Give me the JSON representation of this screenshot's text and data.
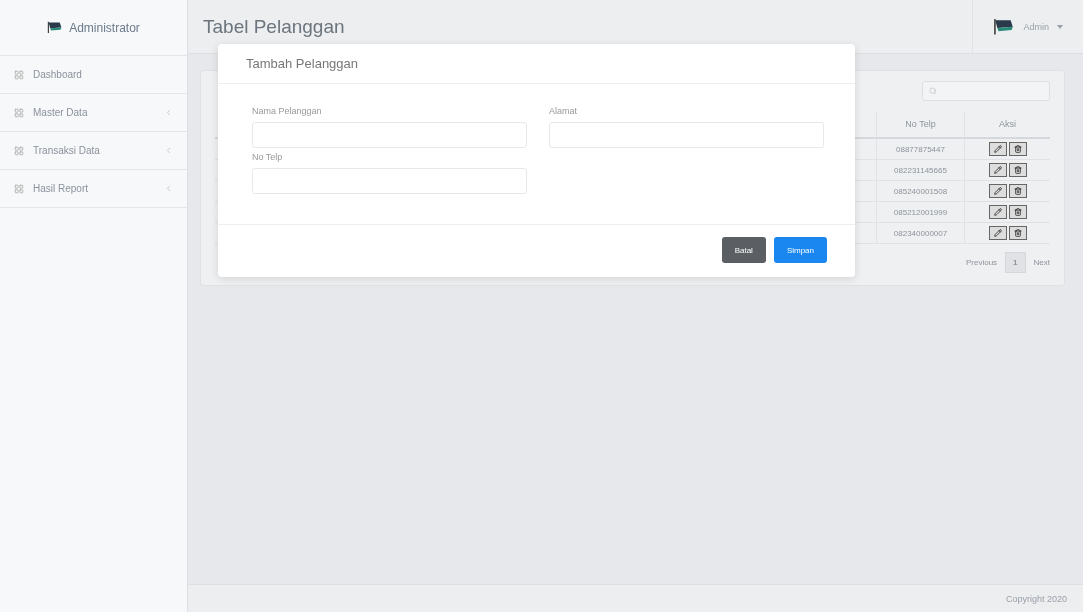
{
  "sidebar": {
    "brand": "Administrator",
    "items": [
      {
        "label": "Dashboard",
        "expandable": false
      },
      {
        "label": "Master Data",
        "expandable": true
      },
      {
        "label": "Transaksi Data",
        "expandable": true
      },
      {
        "label": "Hasil Report",
        "expandable": true
      }
    ]
  },
  "header": {
    "title": "Tabel Pelanggan",
    "user": "Admin"
  },
  "table": {
    "columns": [
      "No Telp",
      "Aksi"
    ],
    "rows": [
      {
        "no_telp": "08877875447"
      },
      {
        "no_telp": "082231145665"
      },
      {
        "no_telp": "085240001508"
      },
      {
        "no_telp": "085212001999"
      },
      {
        "no_telp": "082340000007"
      }
    ]
  },
  "pagination": {
    "previous": "Previous",
    "pages": [
      {
        "label": "1",
        "selected": true
      }
    ],
    "next": "Next"
  },
  "modal": {
    "title": "Tambah Pelanggan",
    "fields": [
      {
        "label": "Nama Pelanggan"
      },
      {
        "label": "Alamat"
      },
      {
        "label": "No Telp"
      }
    ],
    "buttons": [
      {
        "label": "Batal",
        "kind": "secondary"
      },
      {
        "label": "Simpan",
        "kind": "primary"
      }
    ]
  },
  "footer": "Copyright 2020"
}
